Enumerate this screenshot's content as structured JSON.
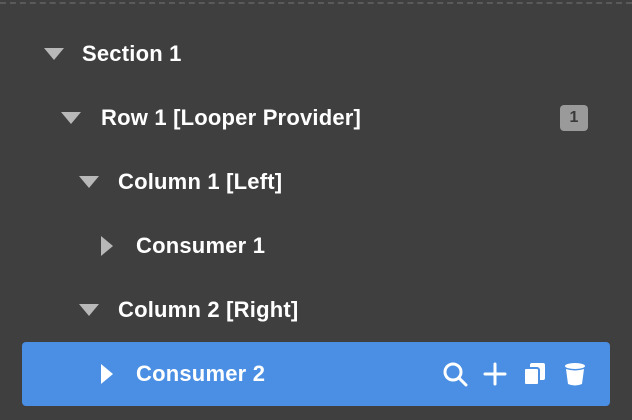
{
  "tree": {
    "rows": [
      {
        "label": "Section 1",
        "expanded": true
      },
      {
        "label": "Row 1 [Looper Provider]",
        "expanded": true,
        "badge": "1"
      },
      {
        "label": "Column 1 [Left]",
        "expanded": true
      },
      {
        "label": "Consumer 1",
        "expanded": false
      },
      {
        "label": "Column 2 [Right]",
        "expanded": true
      },
      {
        "label": "Consumer 2",
        "expanded": false,
        "selected": true
      }
    ],
    "selected_actions": [
      "search-icon",
      "plus-icon",
      "duplicate-icon",
      "trash-icon"
    ]
  },
  "colors": {
    "background": "#3f3f3f",
    "selected_row": "#4a8fe4",
    "badge": "#9a9a9a",
    "caret": "#b8b8b8",
    "text": "#ffffff"
  }
}
